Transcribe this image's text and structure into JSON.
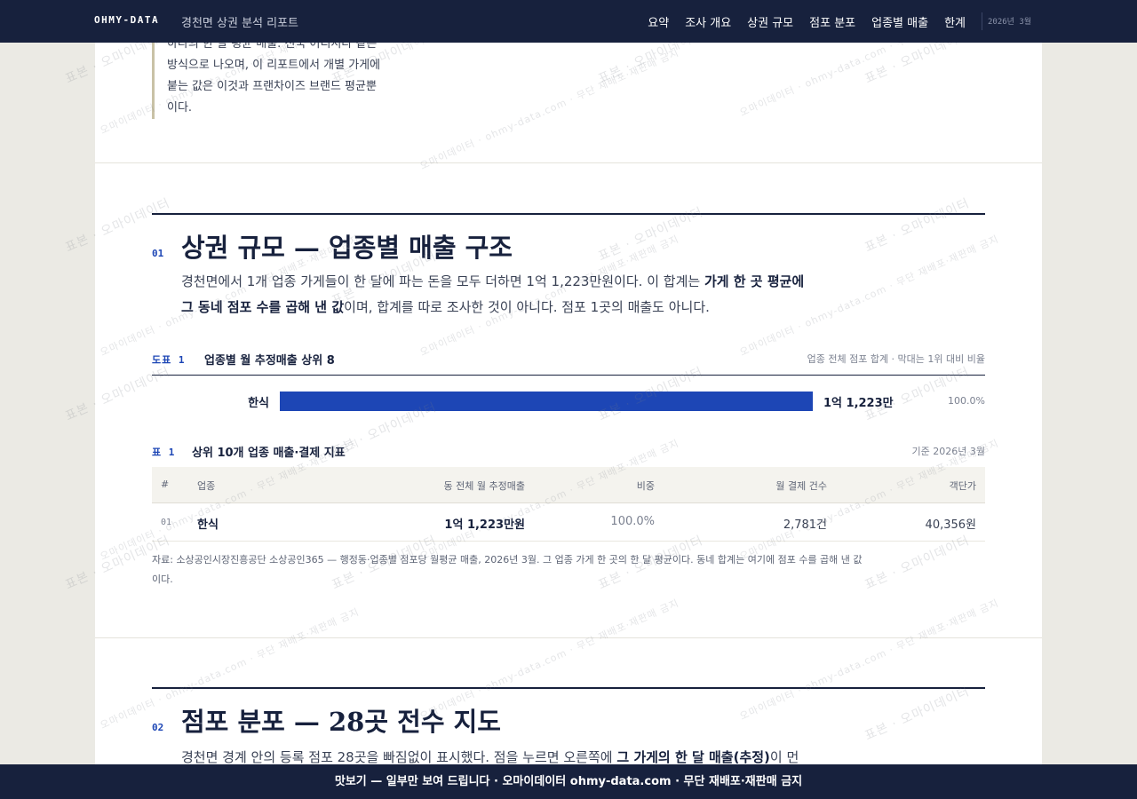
{
  "header": {
    "brand": "OHMY-DATA",
    "title": "경천면 상권 분석 리포트",
    "nav": [
      "요약",
      "조사 개요",
      "상권 규모",
      "점포 분포",
      "업종별 매출",
      "한계"
    ],
    "date": "2026년 3월"
  },
  "intro_quote": {
    "lines": [
      "하나의 한 달 평균 매출. 전국 어디서나 같은",
      "방식으로 나오며, 이 리포트에서 개별 가게에",
      "붙는 값은 이것과 프랜차이즈 브랜드 평균뿐",
      "이다."
    ]
  },
  "section1": {
    "number": "01",
    "title": "상권 규모 — 업종별 매출 구조",
    "lede_line1_a": "경천면에서 1개 업종 가게들이 한 달에 파는 돈을 모두 더하면 1억 1,223만원이다. 이 합계는 ",
    "lede_line1_b": "가게 한 곳 평균에",
    "lede_line2_a": "그 동네 점포 수를 곱해 낸 값",
    "lede_line2_b": "이며, 합계를 따로 조사한 것이 아니다. 점포 1곳의 매출도 아니다.",
    "figure": {
      "label": "도표 1",
      "title": "업종별 월 추정매출 상위 8",
      "note": "업종 전체 점포 합계 · 막대는 1위 대비 비율"
    },
    "table": {
      "label": "표 1",
      "title": "상위 10개 업종 매출·결제 지표",
      "note": "기준 2026년 3월",
      "headers": [
        "#",
        "업종",
        "동 전체 월 추정매출",
        "비중",
        "월 결제 건수",
        "객단가"
      ],
      "rows": [
        {
          "rank": "01",
          "category": "한식",
          "sales": "1억 1,223만원",
          "share": "100.0%",
          "count": "2,781건",
          "avg": "40,356원"
        }
      ]
    },
    "source_line1": "자료: 소상공인시장진흥공단 소상공인365 — 행정동·업종별 점포당 월평균 매출, 2026년 3월. 그 업종 가게 한 곳의 한 달 평균이다. 동네 합계는 여기에 점포 수를 곱해 낸 값",
    "source_line2": "이다."
  },
  "chart_data": {
    "type": "bar",
    "orientation": "horizontal",
    "categories": [
      "한식"
    ],
    "values": [
      11223
    ],
    "value_labels": [
      "1억 1,223만"
    ],
    "share_labels": [
      "100.0%"
    ],
    "unit": "만원",
    "title": "업종별 월 추정매출 상위 8",
    "xlim": [
      0,
      11223
    ],
    "grid": false
  },
  "section2": {
    "number": "02",
    "title": "점포 분포 — 28곳 전수 지도",
    "lede_a": "경천면 경계 안의 등록 점포 28곳을 빠짐없이 표시했다. 점을 누르면 오른쪽에 ",
    "lede_b": "그 가게의 한 달 매출(추정)",
    "lede_c": "이 먼"
  },
  "footer": {
    "text": "맛보기 — 일부만 보여 드립니다 · 오마이데이터 ohmy-data.com · 무단 재배포·재판매 금지"
  },
  "watermark": {
    "primary": "표본 · 오마이데이터",
    "secondary": "오마이데이터 · ohmy-data.com · 무단 재배포·재판매 금지"
  },
  "colors": {
    "navy": "#17213d",
    "accent": "#1d46b5",
    "paper": "#ffffff",
    "background": "#ebeae4"
  }
}
